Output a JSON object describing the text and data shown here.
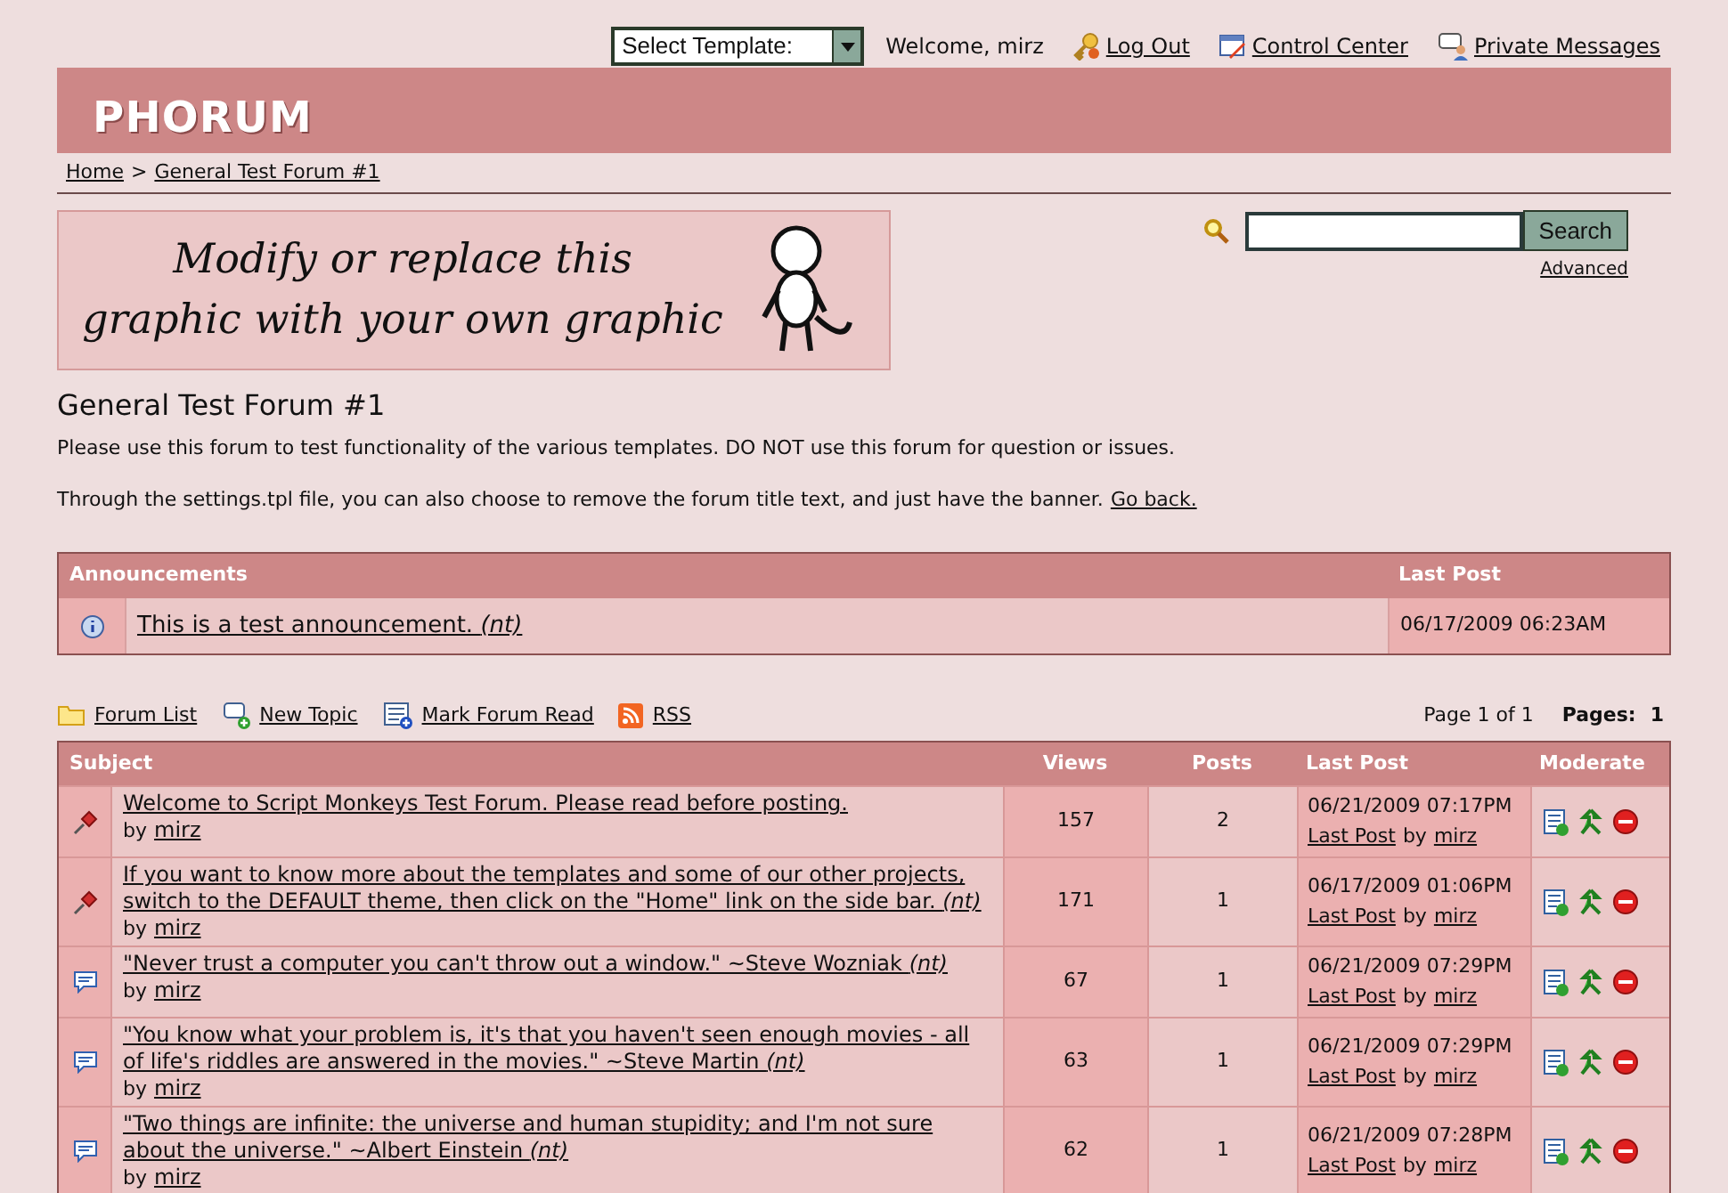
{
  "top_bar": {
    "template_select": "Select Template:",
    "welcome": "Welcome, mirz",
    "links": [
      {
        "kind": "logout",
        "label": "Log Out"
      },
      {
        "kind": "control",
        "label": "Control Center"
      },
      {
        "kind": "messages",
        "label": "Private Messages"
      }
    ]
  },
  "logo": "PHORUM",
  "breadcrumb": {
    "separator": ">",
    "items": [
      "Home",
      "General Test Forum #1"
    ]
  },
  "banner": {
    "lines": [
      "Modify or replace this",
      "graphic with your own graphic"
    ]
  },
  "search": {
    "button": "Search",
    "advanced": "Advanced"
  },
  "forum": {
    "title": "General Test Forum #1",
    "description": "Please use this forum to test functionality of the various templates. DO NOT use this forum for question or issues.",
    "note": "Through the settings.tpl file, you can also choose to remove the forum title text, and just have the banner.",
    "note_link": "Go back."
  },
  "announcements": {
    "columns": [
      "Announcements",
      "Last Post"
    ],
    "rows": [
      {
        "title": "This is a test announcement. *(nt)*",
        "last_post": "06/17/2009 06:23AM"
      }
    ]
  },
  "actions": [
    {
      "kind": "folder",
      "label": "Forum List"
    },
    {
      "kind": "new",
      "label": "New Topic"
    },
    {
      "kind": "read",
      "label": "Mark Forum Read"
    },
    {
      "kind": "rss",
      "label": "RSS"
    }
  ],
  "paging": {
    "page": "Page 1 of 1",
    "pages_label": "Pages:",
    "current": "1"
  },
  "topics": {
    "columns": [
      "Subject",
      "Views",
      "Posts",
      "Last Post",
      "Moderate"
    ],
    "rows": [
      {
        "kind": "sticky",
        "title": "Welcome to Script Monkeys Test Forum. Please read before posting.",
        "by": "by",
        "author": "mirz",
        "views": "157",
        "posts": "2",
        "date": "06/21/2009 07:17PM",
        "last_link": "Last Post",
        "last_by": "by",
        "last_author": "mirz"
      },
      {
        "kind": "sticky",
        "title": "If you want to know more about the templates and some of our other projects, switch to the DEFAULT theme, then click on the \"Home\" link on the side bar. *(nt)*",
        "by": "by",
        "author": "mirz",
        "views": "171",
        "posts": "1",
        "date": "06/17/2009 01:06PM",
        "last_link": "Last Post",
        "last_by": "by",
        "last_author": "mirz"
      },
      {
        "kind": "normal",
        "title": "\"Never trust a computer you can't throw out a window.\" ~Steve Wozniak *(nt)*",
        "by": "by",
        "author": "mirz",
        "views": "67",
        "posts": "1",
        "date": "06/21/2009 07:29PM",
        "last_link": "Last Post",
        "last_by": "by",
        "last_author": "mirz"
      },
      {
        "kind": "normal",
        "title": "\"You know what your problem is, it's that you haven't seen enough movies - all of life's riddles are answered in the movies.\" ~Steve Martin *(nt)*",
        "by": "by",
        "author": "mirz",
        "views": "63",
        "posts": "1",
        "date": "06/21/2009 07:29PM",
        "last_link": "Last Post",
        "last_by": "by",
        "last_author": "mirz"
      },
      {
        "kind": "normal",
        "title": "\"Two things are infinite: the universe and human stupidity; and I'm not sure about the universe.\" ~Albert Einstein *(nt)*",
        "by": "by",
        "author": "mirz",
        "views": "62",
        "posts": "1",
        "date": "06/21/2009 07:28PM",
        "last_link": "Last Post",
        "last_by": "by",
        "last_author": "mirz"
      }
    ]
  }
}
